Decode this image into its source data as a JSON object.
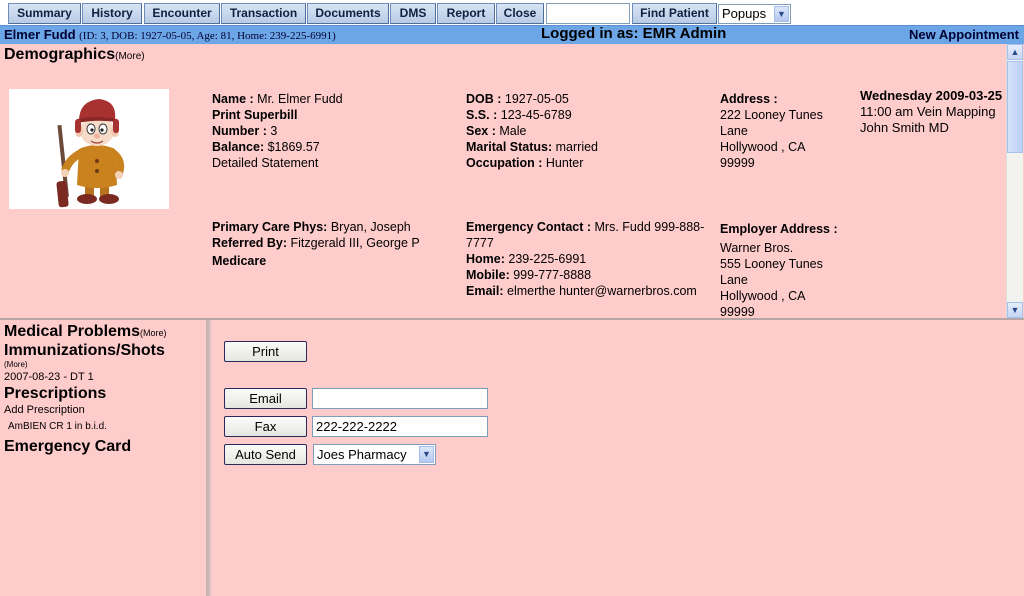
{
  "nav": {
    "tabs": [
      "Summary",
      "History",
      "Encounter",
      "Transaction",
      "Documents",
      "DMS",
      "Report",
      "Close"
    ],
    "search_value": "",
    "find_patient_label": "Find Patient",
    "popups_value": "Popups"
  },
  "titlebar": {
    "patient_name": "Elmer Fudd",
    "patient_meta": "(ID: 3, DOB: 1927-05-05, Age: 81, Home: 239-225-6991)",
    "logged_in": "Logged in as: EMR Admin",
    "new_appointment": "New Appointment"
  },
  "demographics": {
    "heading": "Demographics",
    "more": "(More)",
    "name_label": "Name :",
    "name_value": "Mr. Elmer Fudd",
    "print_superbill": "Print Superbill",
    "number_label": "Number :",
    "number_value": "3",
    "balance_label": "Balance:",
    "balance_value": "$1869.57",
    "detailed_statement": "Detailed Statement",
    "dob_label": "DOB :",
    "dob_value": "1927-05-05",
    "ss_label": "S.S. :",
    "ss_value": "123-45-6789",
    "sex_label": "Sex :",
    "sex_value": "Male",
    "marital_label": "Marital Status:",
    "marital_value": "married",
    "occupation_label": "Occupation :",
    "occupation_value": "Hunter",
    "address_label": "Address :",
    "address_lines": [
      "222 Looney Tunes",
      "Lane",
      "Hollywood , CA",
      "99999"
    ],
    "pcp_label": "Primary Care Phys:",
    "pcp_value": "Bryan, Joseph",
    "referred_label": "Referred By:",
    "referred_value": "Fitzgerald III, George P",
    "insurance": "Medicare",
    "emergency_label": "Emergency Contact :",
    "emergency_value": "Mrs. Fudd 999-888-",
    "emergency_value2": "7777",
    "home_label": "Home:",
    "home_value": "239-225-6991",
    "mobile_label": "Mobile:",
    "mobile_value": "999-777-8888",
    "email_label": "Email:",
    "email_value": "elmerthe hunter@warnerbros.com",
    "employer_label": "Employer Address :",
    "employer_lines": [
      "Warner Bros.",
      "555 Looney Tunes",
      "Lane",
      "Hollywood , CA",
      "99999"
    ],
    "appt_date": "Wednesday 2009-03-25",
    "appt_time": "11:00 am Vein Mapping",
    "appt_provider": "John Smith MD"
  },
  "left_panel": {
    "medical_problems": "Medical Problems",
    "more": "(More)",
    "immunizations": "Immunizations/Shots",
    "immunization_entry": "2007-08-23 - DT 1",
    "prescriptions": "Prescriptions",
    "add_prescription": "Add Prescription",
    "rx_entry": "AmBIEN CR 1 in b.i.d.",
    "emergency_card": "Emergency Card"
  },
  "right_panel": {
    "print_label": "Print",
    "email_label": "Email",
    "email_value": "",
    "fax_label": "Fax",
    "fax_value": "222-222-2222",
    "auto_send_label": "Auto Send",
    "pharmacy_value": "Joes Pharmacy"
  },
  "colors": {
    "panel_bg": "#ffcccc",
    "titlebar_bg": "#6ca6e6",
    "nav_button": "#c8d7ee"
  }
}
